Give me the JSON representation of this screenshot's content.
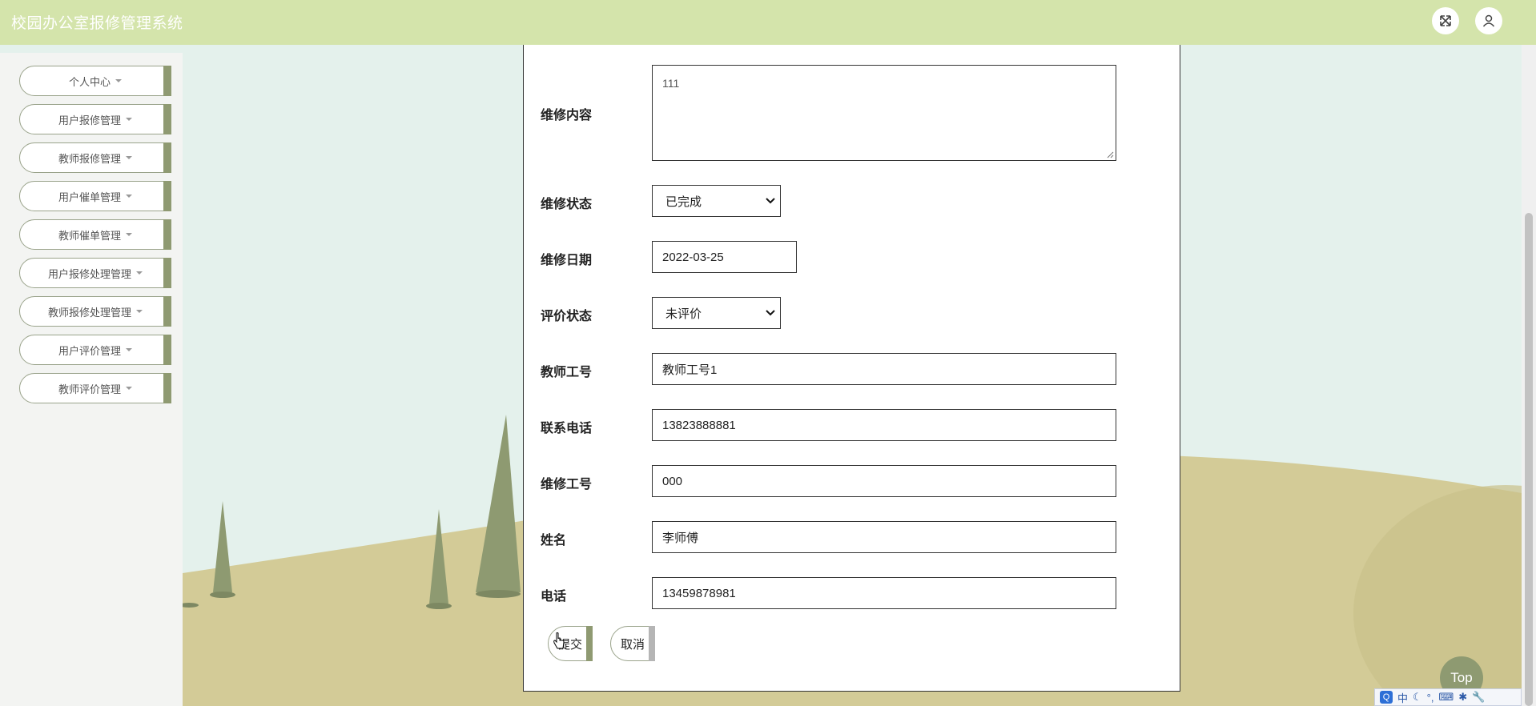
{
  "header": {
    "title": "校园办公室报修管理系统"
  },
  "sidebar": {
    "items": [
      {
        "label": "个人中心"
      },
      {
        "label": "用户报修管理"
      },
      {
        "label": "教师报修管理"
      },
      {
        "label": "用户催单管理"
      },
      {
        "label": "教师催单管理"
      },
      {
        "label": "用户报修处理管理"
      },
      {
        "label": "教师报修处理管理"
      },
      {
        "label": "用户评价管理"
      },
      {
        "label": "教师评价管理"
      }
    ]
  },
  "form": {
    "repair_content": {
      "label": "维修内容",
      "value": "111"
    },
    "repair_status": {
      "label": "维修状态",
      "value": "已完成"
    },
    "repair_date": {
      "label": "维修日期",
      "value": "2022-03-25"
    },
    "review_status": {
      "label": "评价状态",
      "value": "未评价"
    },
    "teacher_id": {
      "label": "教师工号",
      "value": "教师工号1"
    },
    "contact_phone": {
      "label": "联系电话",
      "value": "13823888881"
    },
    "repairer_id": {
      "label": "维修工号",
      "value": "000"
    },
    "name": {
      "label": "姓名",
      "value": "李师傅"
    },
    "phone": {
      "label": "电话",
      "value": "13459878981"
    },
    "submit_label": "提交",
    "cancel_label": "取消"
  },
  "back_to_top": {
    "label": "Top"
  },
  "ime_bar": {
    "lang": "中",
    "q": "Q"
  },
  "colors": {
    "header_bg": "#d4e4ab",
    "accent": "#8f9a72",
    "sky": "#e4f1ec",
    "hill": "#d3cb97",
    "tree": "#8e9a71"
  },
  "icons": {
    "fullscreen": "fullscreen-icon",
    "user": "user-icon"
  }
}
